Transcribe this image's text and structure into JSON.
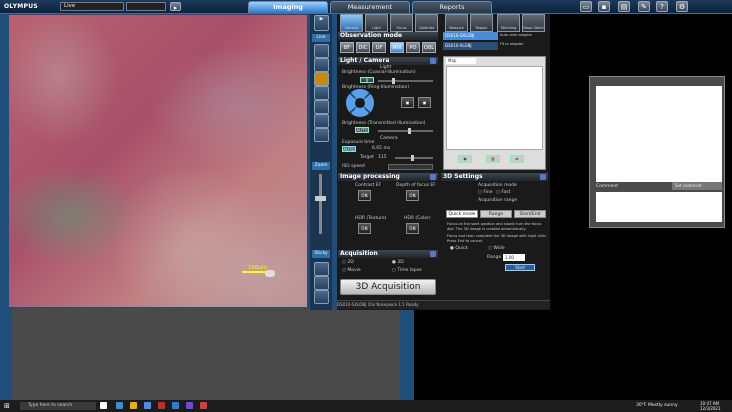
{
  "app": {
    "logo": "OLYMPUS",
    "mode": "Live",
    "mode2": ""
  },
  "tabs": {
    "imaging": "Imaging",
    "measurement": "Measurement",
    "reports": "Reports"
  },
  "toolbar_icons": [
    "monitor-icon",
    "save-icon",
    "print-icon",
    "tools-icon",
    "help-icon",
    "config-icon"
  ],
  "left": {
    "scale": "150um",
    "vstrip": [
      "Live",
      "Focus"
    ],
    "vstrip_top": "Imaging\n2D",
    "zoom_label": "Zoom",
    "zoom_val": "x1.0",
    "sticky": "Sticky"
  },
  "ribbon": [
    "Camera",
    "Light",
    "Focus",
    "Calibrate",
    "Measure",
    "Region",
    "Stitching",
    "Deep Stitch"
  ],
  "observation": {
    "title": "Observation mode",
    "buttons": [
      "BF",
      "DIC",
      "DF",
      "MIX",
      "PO",
      "OBL"
    ],
    "selected_index": 3
  },
  "light_camera": {
    "title": "Light / Camera",
    "light": "Light",
    "brightness1": "Brightness (Coaxial-Illumination)",
    "brightness2": "Brightness (Ring-Illumination)",
    "brightness3": "Brightness (Transmitted Illumination)",
    "value": "0",
    "auto1": "AUTO",
    "exposure_label": "Exposure time",
    "exposure_auto": "AUTO",
    "exposure": "6.65 ms",
    "target_label": "Target",
    "target": "115",
    "iso_label": "ISO speed",
    "camera": "Camera"
  },
  "image_processing": {
    "title": "Image processing",
    "contrast": "Contrast EF",
    "depth": "Depth of focus EF",
    "hdr_texture": "HDR (Texture)",
    "hdr_color": "HDR (Color)",
    "on": "ON"
  },
  "acquisition": {
    "title": "Acquisition",
    "opt_2d": "2D",
    "opt_3d": "3D",
    "opt_movie": "Movie",
    "opt_timelapse": "Time lapse",
    "button": "3D Acquisition"
  },
  "side_panel": {
    "tab1": "DSX10-SXLOBJ",
    "tab2": "DSX10-XLOBJ",
    "check1": "Auto slide adapter",
    "check2": "Fit to adapter",
    "list_tab": "Map"
  },
  "settings_3d": {
    "title": "3D Settings",
    "acq_mode": "Acquisition mode",
    "fine": "Fine",
    "fast": "Fast",
    "range": "Acquisition range",
    "tabs": [
      "Quick mode",
      "Range",
      "Start/End"
    ],
    "desc": "Focus on the start position and slowly turn the focus dial. The 3D image is created automatically.",
    "desc2": "Focus and then complete the 3D image with right click. Press End to cancel.",
    "quick": "Quick",
    "wide": "Wide",
    "range_label": "Range",
    "range_val": "1.00",
    "start": "Start"
  },
  "comment": {
    "label": "Comment",
    "field": "Set comment"
  },
  "statusbar": "DSX10-SXLOBJ  10x  Nosepiece 1:1  Ready",
  "taskbar": {
    "search": "Type here to search",
    "time": "10:47 AM",
    "date": "12/3/2021",
    "weather": "30°F  Mostly sunny"
  }
}
